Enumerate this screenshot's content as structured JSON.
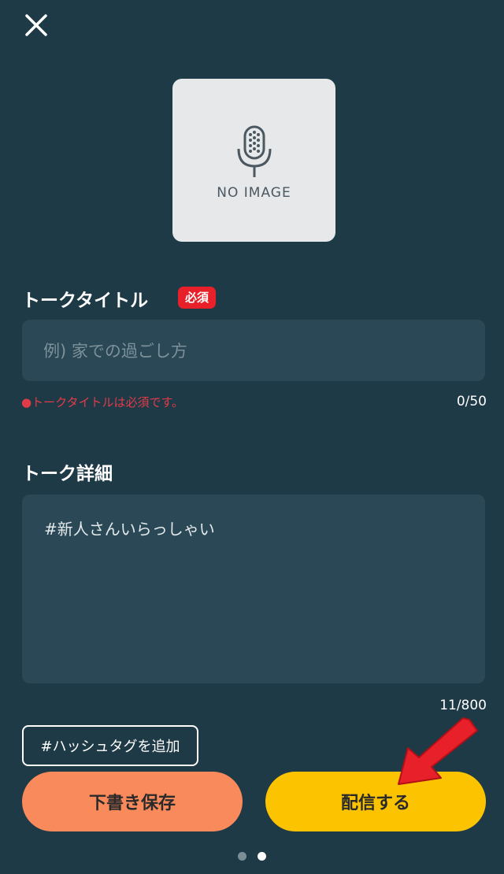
{
  "header": {
    "close_icon": "close-icon"
  },
  "thumbnail": {
    "icon": "microphone-icon",
    "label": "NO IMAGE"
  },
  "title_section": {
    "label": "トークタイトル",
    "required_badge": "必須",
    "placeholder": "例) 家での過ごし方",
    "value": "",
    "error": "●トークタイトルは必須です。",
    "counter": "0/50"
  },
  "detail_section": {
    "label": "トーク詳細",
    "value": "#新人さんいらっしゃい",
    "counter": "11/800"
  },
  "hashtag_button": {
    "label": "#ハッシュタグを追加"
  },
  "actions": {
    "draft_label": "下書き保存",
    "publish_label": "配信する"
  },
  "pagination": {
    "total": 2,
    "current": 2
  },
  "colors": {
    "background": "#1f3a47",
    "field": "#2a4856",
    "required": "#e8202a",
    "error": "#e23b48",
    "draft_button": "#f98a5c",
    "publish_button": "#fcc400",
    "annotation_arrow": "#e8202a"
  }
}
